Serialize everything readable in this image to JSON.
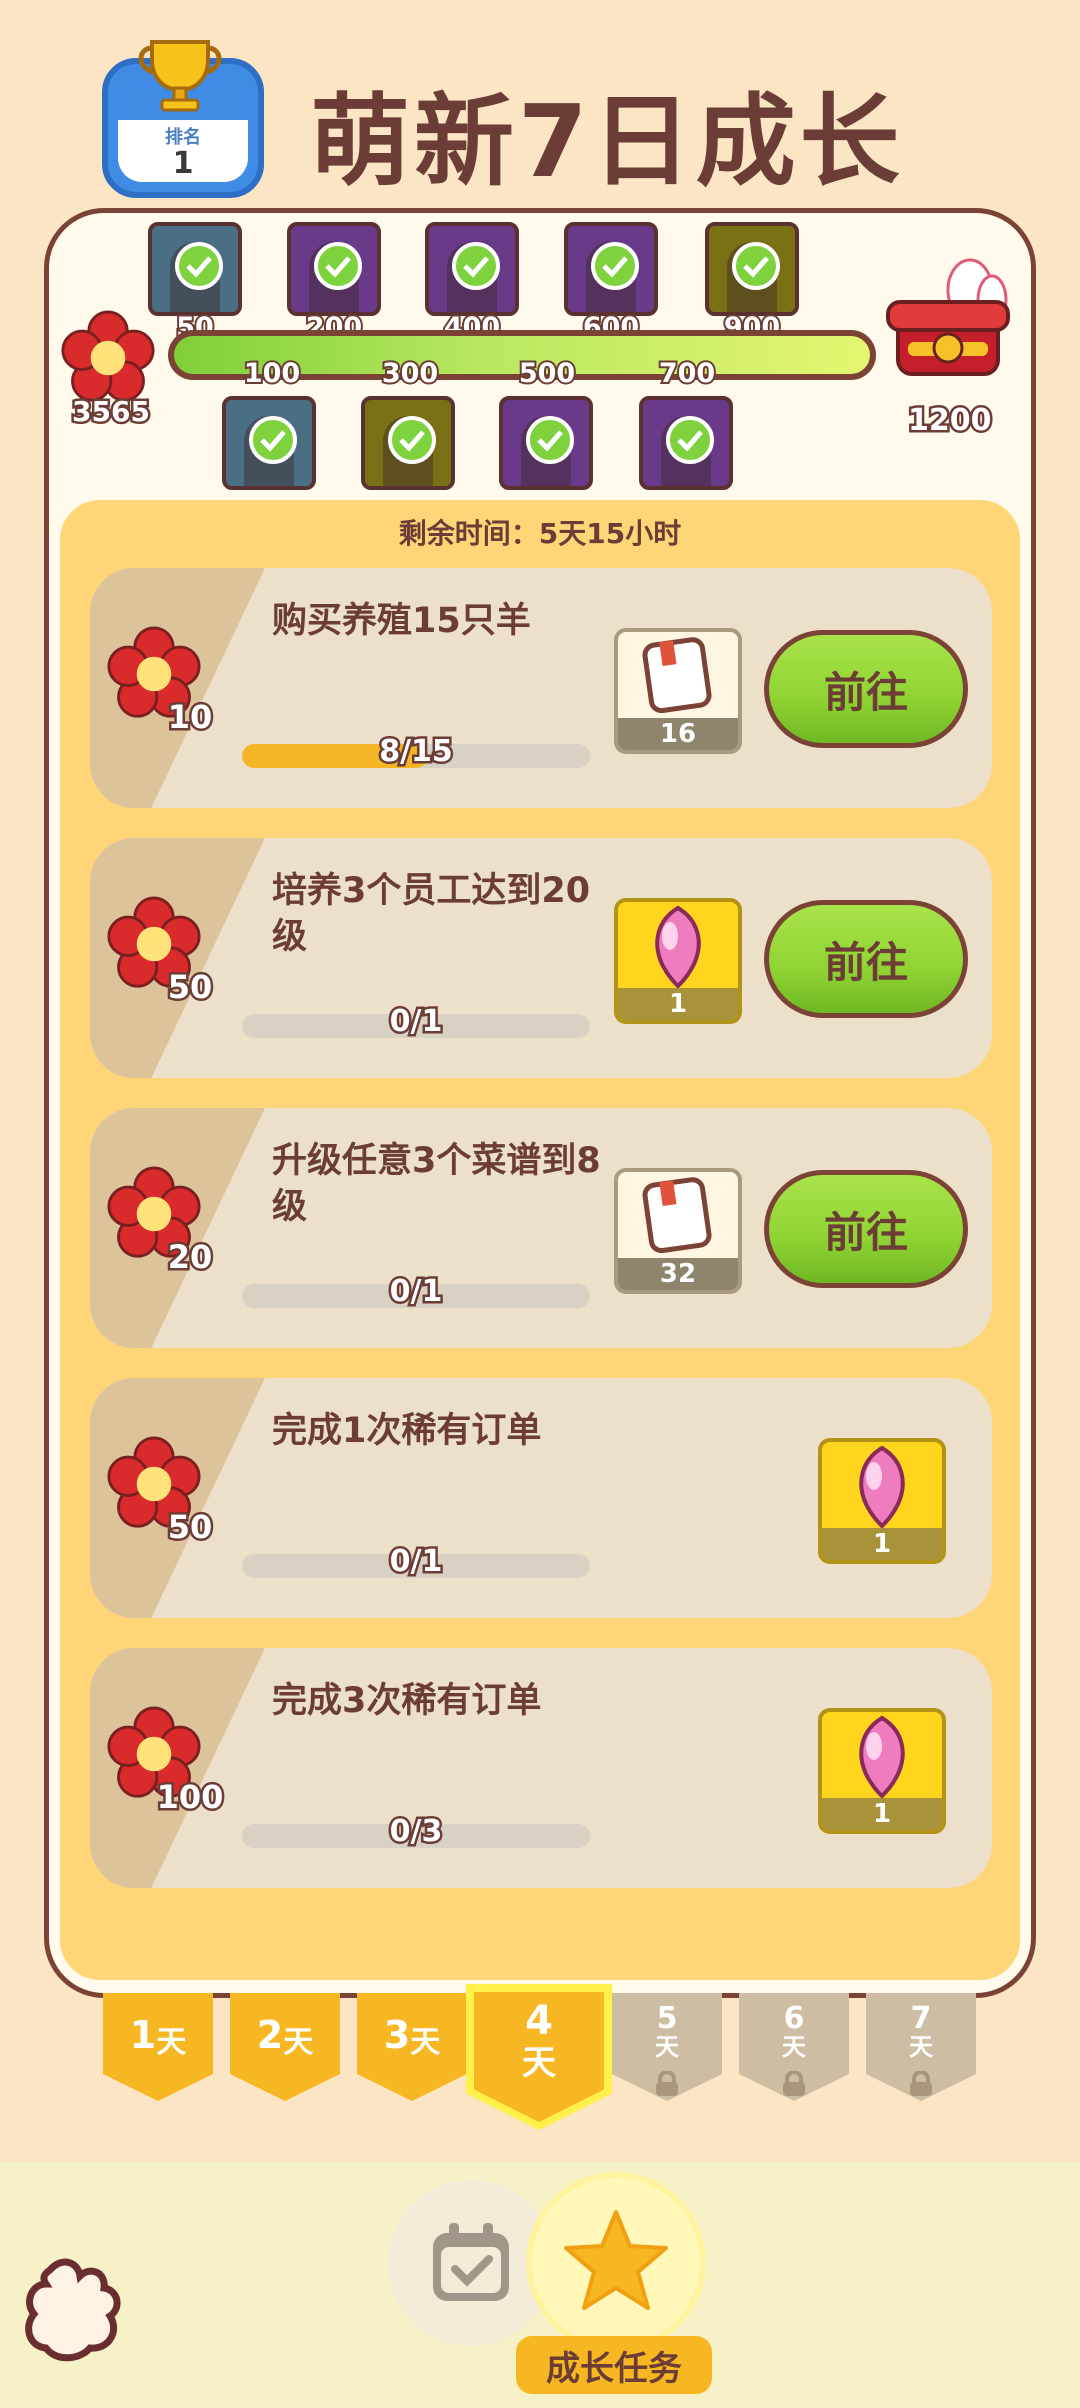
{
  "header": {
    "rank_label": "排名",
    "rank_value": "1",
    "title": "萌新7日成长"
  },
  "milestones": {
    "total_points": "3565",
    "chest_points": "1200",
    "top": [
      "50",
      "200",
      "400",
      "600",
      "900"
    ],
    "bottom": [
      "100",
      "300",
      "500",
      "700"
    ]
  },
  "time_left": "剩余时间：5天15小时",
  "tasks": [
    {
      "points": "10",
      "text": "购买养殖15只羊",
      "progress": "8/15",
      "progress_fraction": 0.5333,
      "reward_icon": "book-icon",
      "reward_count": "16",
      "button": "前往"
    },
    {
      "points": "50",
      "text": "培养3个员工达到20级",
      "progress": "0/1",
      "progress_fraction": 0,
      "reward_icon": "pink-gem-icon",
      "reward_count": "1",
      "button": "前往"
    },
    {
      "points": "20",
      "text": "升级任意3个菜谱到8级",
      "progress": "0/1",
      "progress_fraction": 0,
      "reward_icon": "book-icon",
      "reward_count": "32",
      "button": "前往"
    },
    {
      "points": "50",
      "text": "完成1次稀有订单",
      "progress": "0/1",
      "progress_fraction": 0,
      "reward_icon": "pink-gem-icon",
      "reward_count": "1"
    },
    {
      "points": "100",
      "text": "完成3次稀有订单",
      "progress": "0/3",
      "progress_fraction": 0,
      "reward_icon": "pink-gem-icon",
      "reward_count": "1"
    }
  ],
  "days": {
    "d1_num": "1",
    "d2_num": "2",
    "d3_num": "3",
    "d4_num": "4",
    "d5_num": "5",
    "d6_num": "6",
    "d7_num": "7",
    "day_suffix": "天",
    "active_day": 4
  },
  "bottom_nav": {
    "active_label": "成长任务"
  },
  "colors": {
    "background": "#fbe5c4",
    "accent_green": "#8fd332",
    "accent_yellow": "#f6b722",
    "text_brown": "#6b3d36"
  }
}
